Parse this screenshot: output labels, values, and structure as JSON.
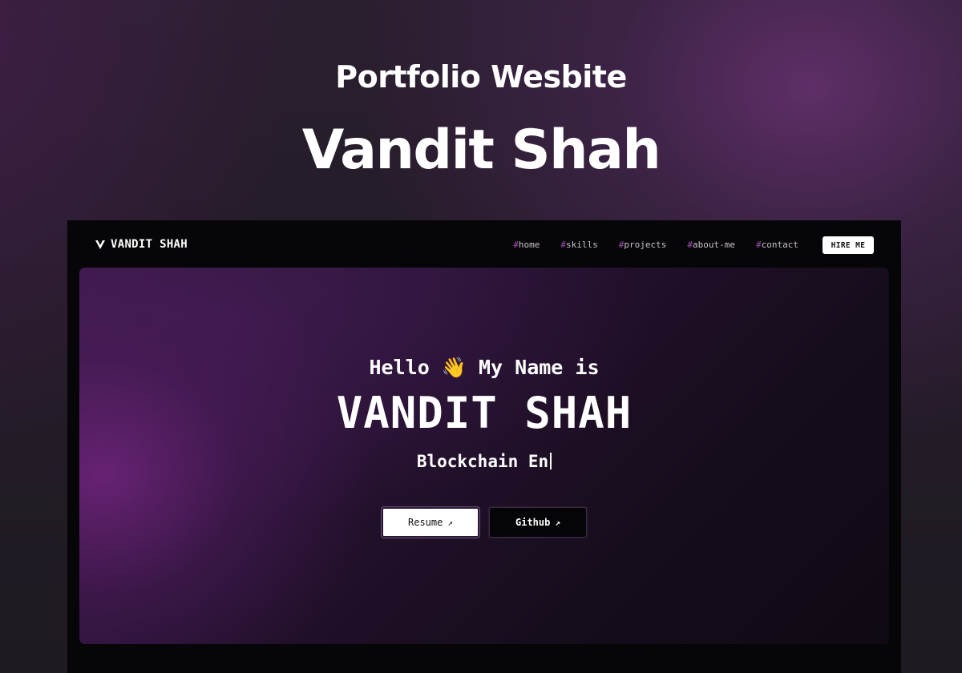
{
  "promo": {
    "subtitle": "Portfolio Wesbite",
    "title": "Vandit Shah"
  },
  "navbar": {
    "brand": "VANDIT SHAH",
    "logo_icon": "v-logo-icon",
    "links": [
      {
        "hash": "#",
        "label": "home"
      },
      {
        "hash": "#",
        "label": "skills"
      },
      {
        "hash": "#",
        "label": "projects"
      },
      {
        "hash": "#",
        "label": "about-me"
      },
      {
        "hash": "#",
        "label": "contact"
      }
    ],
    "cta": "HIRE ME"
  },
  "hero": {
    "greeting": "Hello 👋 My Name is",
    "name": "VANDIT SHAH",
    "role": "Blockchain En",
    "buttons": {
      "resume": "Resume",
      "github": "Github",
      "arrow": "↗"
    }
  },
  "colors": {
    "accent": "#9b4fb0",
    "hero_glow": "#70247c",
    "frame_bg": "#060507"
  }
}
